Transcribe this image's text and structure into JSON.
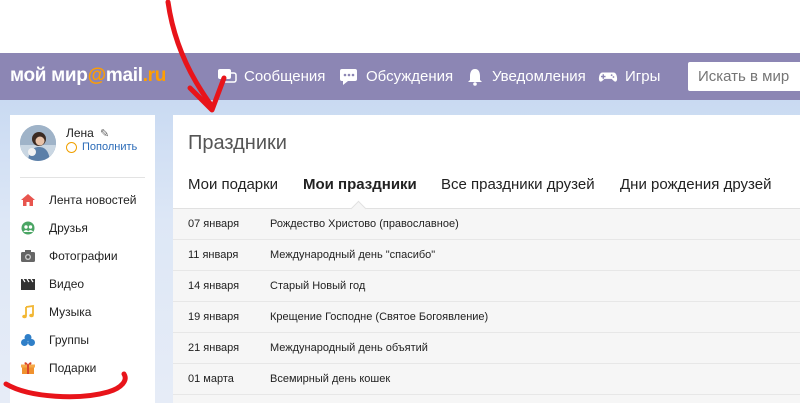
{
  "header": {
    "logo": {
      "part1": "мой мир",
      "at": "@",
      "part2": "mail",
      "dot_ru": ".ru"
    },
    "nav": [
      {
        "label": "Сообщения",
        "icon": "chat-bubbles-icon"
      },
      {
        "label": "Обсуждения",
        "icon": "speech-bubble-icon"
      },
      {
        "label": "Уведомления",
        "icon": "bell-icon"
      },
      {
        "label": "Игры",
        "icon": "gamepad-icon"
      }
    ],
    "search_placeholder": "Искать в мире"
  },
  "sidebar": {
    "user_name": "Лена",
    "topup_label": "Пополнить",
    "items": [
      {
        "label": "Лента новостей",
        "icon": "home-icon"
      },
      {
        "label": "Друзья",
        "icon": "friends-icon"
      },
      {
        "label": "Фотографии",
        "icon": "camera-icon"
      },
      {
        "label": "Видео",
        "icon": "clapperboard-icon"
      },
      {
        "label": "Музыка",
        "icon": "music-note-icon"
      },
      {
        "label": "Группы",
        "icon": "groups-icon"
      },
      {
        "label": "Подарки",
        "icon": "gift-icon"
      }
    ]
  },
  "main": {
    "title": "Праздники",
    "tabs": [
      {
        "label": "Мои подарки",
        "active": false
      },
      {
        "label": "Мои праздники",
        "active": true
      },
      {
        "label": "Все праздники друзей",
        "active": false
      },
      {
        "label": "Дни рождения друзей",
        "active": false
      }
    ],
    "holidays": [
      {
        "date": "07 января",
        "name": "Рождество Христово (православное)"
      },
      {
        "date": "11 января",
        "name": "Международный день \"спасибо\""
      },
      {
        "date": "14 января",
        "name": "Старый Новый год"
      },
      {
        "date": "19 января",
        "name": "Крещение Господне (Святое Богоявление)"
      },
      {
        "date": "21 января",
        "name": "Международный день объятий"
      },
      {
        "date": "01 марта",
        "name": "Всемирный день кошек"
      }
    ]
  },
  "colors": {
    "header_bg": "#8c86b4",
    "logo_accent": "#ff9e00",
    "link": "#2a6bb8",
    "annotation_red": "#e8141a"
  }
}
